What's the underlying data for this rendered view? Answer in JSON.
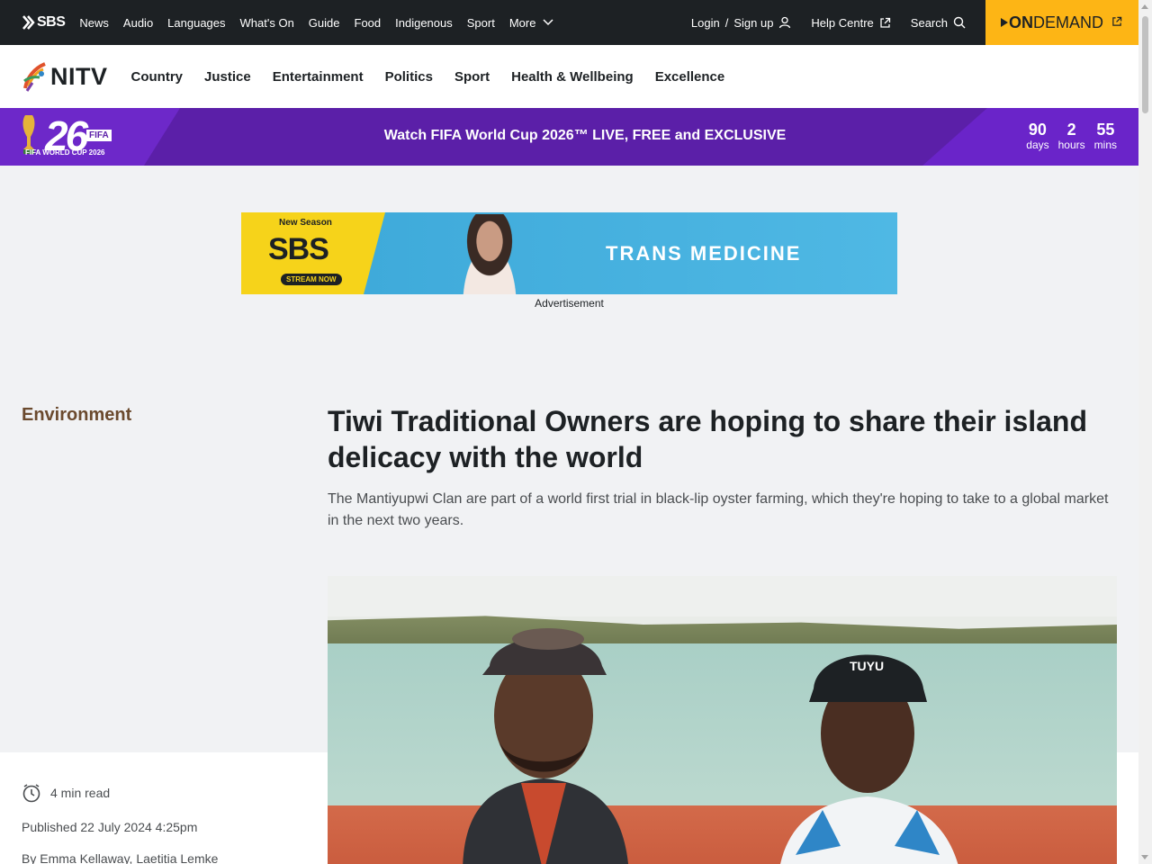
{
  "topbar": {
    "brand": "SBS",
    "nav": [
      "News",
      "Audio",
      "Languages",
      "What's On",
      "Guide",
      "Food",
      "Indigenous",
      "Sport",
      "More"
    ],
    "login": "Login",
    "signup": "Sign up",
    "help": "Help Centre",
    "search": "Search",
    "ondemand_on": "ON",
    "ondemand_rest": "DEMAND"
  },
  "nitv": {
    "brand": "NITV",
    "nav": [
      "Country",
      "Justice",
      "Entertainment",
      "Politics",
      "Sport",
      "Health & Wellbeing",
      "Excellence"
    ]
  },
  "fifa": {
    "number": "26",
    "badge": "FIFA",
    "sub": "FIFA WORLD CUP 2026",
    "text": "Watch FIFA World Cup 2026™ LIVE, FREE and EXCLUSIVE",
    "countdown": [
      {
        "value": "90",
        "unit": "days"
      },
      {
        "value": "2",
        "unit": "hours"
      },
      {
        "value": "55",
        "unit": "mins"
      }
    ]
  },
  "ad": {
    "new_season": "New Season",
    "brand": "SBS",
    "stream_now": "STREAM NOW",
    "title": "TRANS MEDICINE",
    "label": "Advertisement"
  },
  "article": {
    "category": "Environment",
    "headline": "Tiwi Traditional Owners are hoping to share their island delicacy with the world",
    "standfirst": "The Mantiyupwi Clan are part of a world first trial in black-lip oyster farming, which they're hoping to take to a global market in the next two years.",
    "read_time": "4 min read",
    "published": "Published 22 July 2024 4:25pm",
    "byline": "By Emma Kellaway, Laetitia Lemke"
  },
  "colors": {
    "topbar": "#1d2124",
    "ondemand": "#fdb515",
    "fifa": "#5b1fa8",
    "category": "#6b4a2e"
  }
}
